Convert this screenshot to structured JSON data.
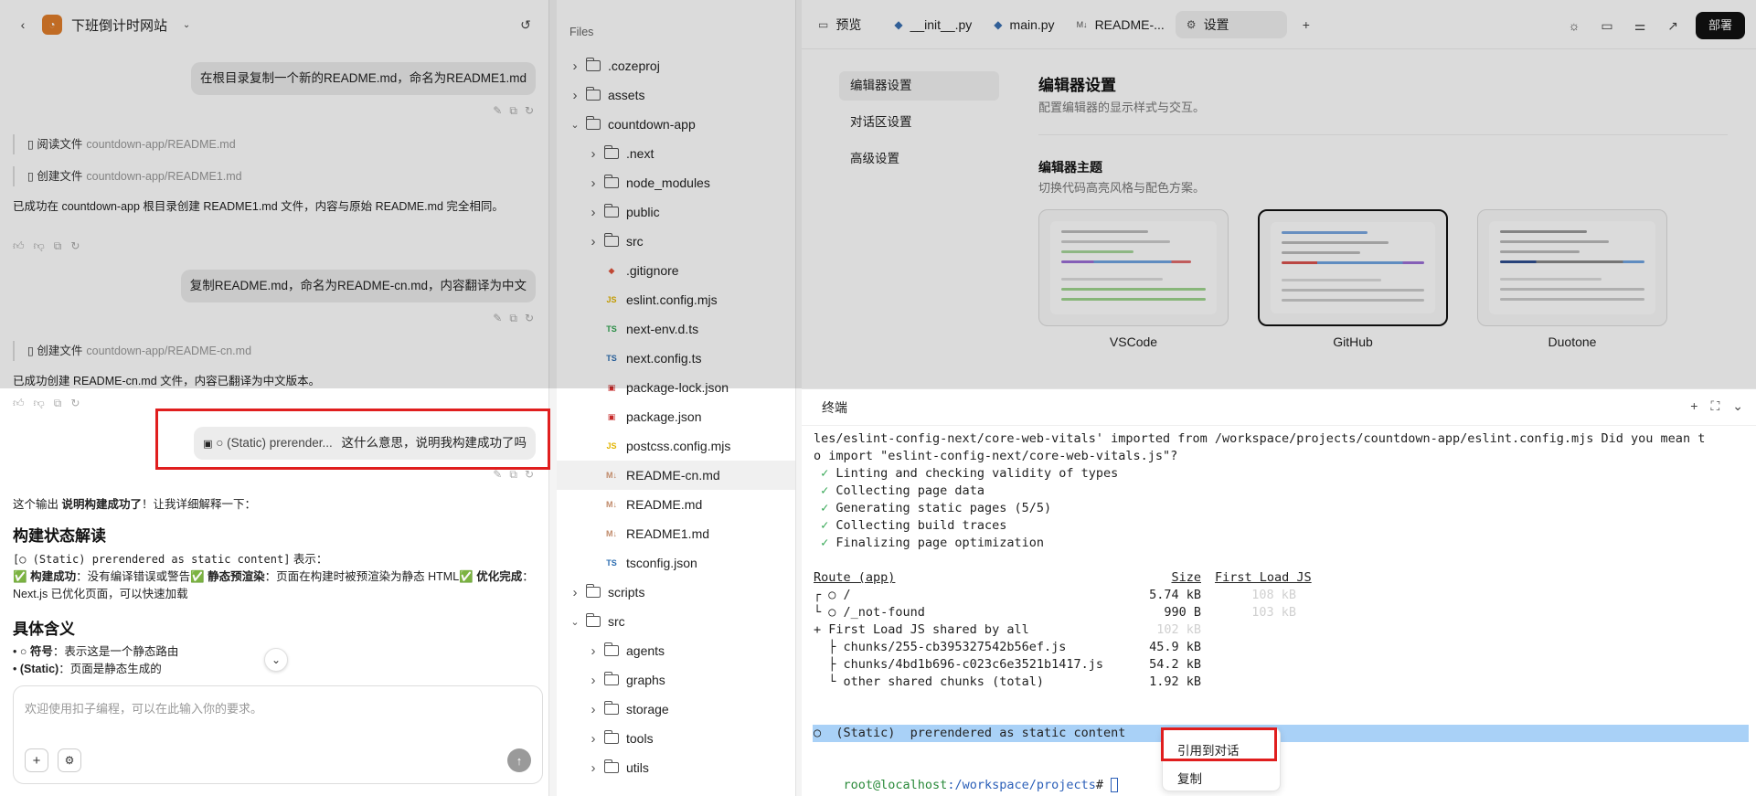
{
  "chat": {
    "project_title": "下班倒计时网站",
    "messages": {
      "user1": "在根目录复制一个新的README.md，命名为README1.md",
      "op_read_label": "阅读文件",
      "op_read_path": "countdown-app/README.md",
      "op_create1_label": "创建文件",
      "op_create1_path": "countdown-app/README1.md",
      "bot1": "已成功在 countdown-app 根目录创建 README1.md 文件，内容与原始 README.md 完全相同。",
      "user2": "复制README.md，命名为README-cn.md，内容翻译为中文",
      "op_create2_label": "创建文件",
      "op_create2_path": "countdown-app/README-cn.md",
      "bot2": "已成功创建 README-cn.md 文件，内容已翻译为中文版本。",
      "user3_ref": "○ (Static) prerender...",
      "user3_text": "这什么意思，说明我构建成功了吗",
      "bot3_intro_a": "这个输出 ",
      "bot3_intro_b": "说明构建成功了",
      "bot3_intro_c": "！让我详细解释一下：",
      "h_status": "构建状态解读",
      "status_code": "[○ (Static) prerendered as static content]",
      "status_code_suffix": " 表示：",
      "ok1_b": "构建成功",
      "ok1_t": "：没有编译错误或警告",
      "ok2_b": "静态预渲染",
      "ok2_t": "：页面在构建时被预渲染为静态 HTML",
      "ok3_b": "优化完成",
      "ok3_t": "：Next.js 已优化页面，可以快速加载",
      "h_meaning": "具体含义",
      "li1_b": "○ 符号",
      "li1_t": "：表示这是一个静态路由",
      "li2_b": "(Static)",
      "li2_t": "：页面是静态生成的"
    },
    "input_placeholder": "欢迎使用扣子编程，可以在此输入你的要求。"
  },
  "files": {
    "title": "Files",
    "items": [
      {
        "name": ".cozeproj",
        "type": "folder",
        "depth": 0,
        "open": false
      },
      {
        "name": "assets",
        "type": "folder",
        "depth": 0,
        "open": false
      },
      {
        "name": "countdown-app",
        "type": "folder",
        "depth": 0,
        "open": true
      },
      {
        "name": ".next",
        "type": "folder",
        "depth": 1,
        "open": false
      },
      {
        "name": "node_modules",
        "type": "folder",
        "depth": 1,
        "open": false
      },
      {
        "name": "public",
        "type": "folder",
        "depth": 1,
        "open": false
      },
      {
        "name": "src",
        "type": "folder",
        "depth": 1,
        "open": false
      },
      {
        "name": ".gitignore",
        "type": "git",
        "depth": 1
      },
      {
        "name": "eslint.config.mjs",
        "type": "js",
        "depth": 1
      },
      {
        "name": "next-env.d.ts",
        "type": "ts-green",
        "depth": 1
      },
      {
        "name": "next.config.ts",
        "type": "ts",
        "depth": 1
      },
      {
        "name": "package-lock.json",
        "type": "npm",
        "depth": 1
      },
      {
        "name": "package.json",
        "type": "npm",
        "depth": 1
      },
      {
        "name": "postcss.config.mjs",
        "type": "js",
        "depth": 1
      },
      {
        "name": "README-cn.md",
        "type": "md",
        "depth": 1,
        "active": true
      },
      {
        "name": "README.md",
        "type": "md",
        "depth": 1
      },
      {
        "name": "README1.md",
        "type": "md",
        "depth": 1
      },
      {
        "name": "tsconfig.json",
        "type": "ts",
        "depth": 1
      },
      {
        "name": "scripts",
        "type": "folder",
        "depth": 0,
        "open": false
      },
      {
        "name": "src",
        "type": "folder",
        "depth": 0,
        "open": true
      },
      {
        "name": "agents",
        "type": "folder",
        "depth": 1,
        "open": false
      },
      {
        "name": "graphs",
        "type": "folder",
        "depth": 1,
        "open": false
      },
      {
        "name": "storage",
        "type": "folder",
        "depth": 1,
        "open": false
      },
      {
        "name": "tools",
        "type": "folder",
        "depth": 1,
        "open": false
      },
      {
        "name": "utils",
        "type": "folder",
        "depth": 1,
        "open": false
      }
    ]
  },
  "editor": {
    "tabs": [
      {
        "label": "预览",
        "icon": "preview-icon"
      },
      {
        "label": "__init__.py",
        "icon": "python-icon"
      },
      {
        "label": "main.py",
        "icon": "python-icon"
      },
      {
        "label": "README-...",
        "icon": "markdown-icon"
      },
      {
        "label": "设置",
        "icon": "settings-icon",
        "active": true
      }
    ],
    "deploy_label": "部署",
    "settings_nav": [
      "编辑器设置",
      "对话区设置",
      "高级设置"
    ],
    "settings_title": "编辑器设置",
    "settings_desc": "配置编辑器的显示样式与交互。",
    "theme_title": "编辑器主题",
    "theme_desc": "切换代码高亮风格与配色方案。",
    "themes": [
      {
        "name": "VSCode",
        "selected": false
      },
      {
        "name": "GitHub",
        "selected": true
      },
      {
        "name": "Duotone",
        "selected": false
      }
    ]
  },
  "terminal": {
    "title": "终端",
    "lines": {
      "l1": "les/eslint-config-next/core-web-vitals' imported from /workspace/projects/countdown-app/eslint.config.mjs Did you mean t",
      "l2": "o import \"eslint-config-next/core-web-vitals.js\"?",
      "l3": "Linting and checking validity of types",
      "l4": "Collecting page data",
      "l5": "Generating static pages (5/5)",
      "l6": "Collecting build traces",
      "l7": "Finalizing page optimization",
      "route_h": "Route (app)",
      "size_h": "Size",
      "fl_h": "First Load JS",
      "r1": "┌ ○ /",
      "r1_size": "5.74 kB",
      "r1_fl": "108 kB",
      "r2": "└ ○ /_not-found",
      "r2_size": "990 B",
      "r2_fl": "103 kB",
      "shared": "+ First Load JS shared by all",
      "shared_fl": "102 kB",
      "c1": "  ├ chunks/255-cb395327542b56ef.js",
      "c1_size": "45.9 kB",
      "c2": "  ├ chunks/4bd1b696-c023c6e3521b1417.js",
      "c2_size": "54.2 kB",
      "c3": "  └ other shared chunks (total)",
      "c3_size": "1.92 kB",
      "static_line": "○  (Static)  prerendered as static content",
      "prompt_user": "root",
      "prompt_host": "@localhost",
      "prompt_path": ":/workspace/projects",
      "prompt_end": "# "
    },
    "context_menu": [
      "引用到对话",
      "复制"
    ]
  },
  "colors": {
    "highlight_red": "#e01e1e",
    "selection_blue": "#a9d1f7",
    "check_green": "#2ea44f",
    "prompt_green": "#2a8a3a",
    "prompt_blue": "#2b5fb8"
  }
}
